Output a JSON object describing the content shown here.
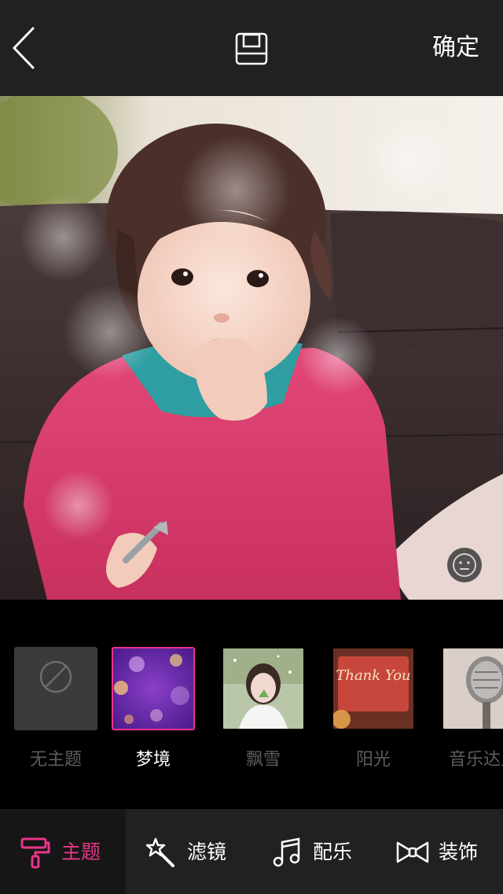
{
  "header": {
    "confirm_label": "确定"
  },
  "themes": [
    {
      "label": "无主题",
      "selected": false
    },
    {
      "label": "梦境",
      "selected": true
    },
    {
      "label": "飘雪",
      "selected": false
    },
    {
      "label": "阳光",
      "selected": false
    },
    {
      "label": "音乐达人",
      "selected": false
    }
  ],
  "thumb_text": {
    "sunshine": "Thank You"
  },
  "tabs": [
    {
      "label": "主题",
      "icon": "paint-roller-icon",
      "active": true
    },
    {
      "label": "滤镜",
      "icon": "magic-wand-icon",
      "active": false
    },
    {
      "label": "配乐",
      "icon": "music-note-icon",
      "active": false
    },
    {
      "label": "装饰",
      "icon": "bow-tie-icon",
      "active": false
    }
  ],
  "colors": {
    "accent": "#e8358a",
    "bar_background": "#212121",
    "inactive_text": "#5d5d5d"
  }
}
